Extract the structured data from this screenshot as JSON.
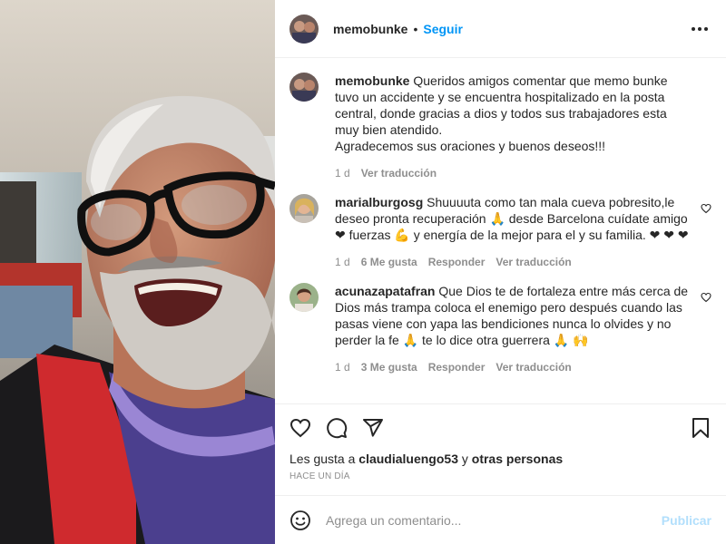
{
  "post": {
    "author": "memobunke",
    "separator": "•",
    "follow_label": "Seguir"
  },
  "caption": {
    "username": "memobunke",
    "text": "Queridos amigos comentar que memo bunke tuvo un accidente y se encuentra hospitalizado en la posta central, donde gracias a dios y todos sus trabajadores esta muy bien atendido.\nAgradecemos sus oraciones y buenos deseos!!!",
    "age": "1 d",
    "translate": "Ver traducción"
  },
  "comments": [
    {
      "username": "marialburgosg",
      "text": "Shuuuuta como tan mala cueva pobresito,le deseo pronta recuperación 🙏 desde Barcelona cuídate amigo ❤ fuerzas 💪 y energía de la mejor para el y su familia. ❤ ❤ ❤",
      "age": "1 d",
      "likes": "6 Me gusta",
      "reply": "Responder",
      "translate": "Ver traducción"
    },
    {
      "username": "acunazapatafran",
      "text": "Que Dios te de fortaleza entre más cerca de Dios más trampa coloca el enemigo pero después cuando las pasas viene con yapa las bendiciones nunca lo olvides y no perder la fe 🙏 te lo dice otra guerrera 🙏 🙌",
      "age": "1 d",
      "likes": "3 Me gusta",
      "reply": "Responder",
      "translate": "Ver traducción"
    }
  ],
  "likes_line": {
    "prefix": "Les gusta a",
    "user": "claudialuengo53",
    "joiner": "y",
    "others": "otras personas"
  },
  "posted": "HACE UN DÍA",
  "add_comment": {
    "placeholder": "Agrega un comentario...",
    "post_label": "Publicar"
  },
  "icons": {
    "more": "more-options-icon",
    "like": "heart-icon",
    "comment": "comment-icon",
    "share": "share-icon",
    "save": "bookmark-icon",
    "emoji": "emoji-icon"
  },
  "colors": {
    "link": "#0095f6",
    "muted": "#8e8e8e",
    "text": "#262626",
    "post_disabled": "#b2dffc",
    "heart": "#ed4956"
  }
}
